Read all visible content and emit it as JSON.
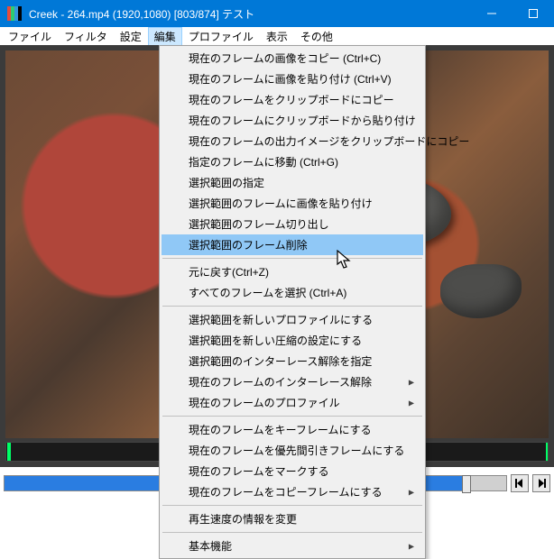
{
  "title": "Creek - 264.mp4 (1920,1080)  [803/874]  テスト",
  "menubar": [
    "ファイル",
    "フィルタ",
    "設定",
    "編集",
    "プロファイル",
    "表示",
    "その他"
  ],
  "menubar_open_index": 3,
  "dropdown": {
    "groups": [
      [
        {
          "label": "現在のフレームの画像をコピー (Ctrl+C)",
          "sub": false
        },
        {
          "label": "現在のフレームに画像を貼り付け (Ctrl+V)",
          "sub": false
        },
        {
          "label": "現在のフレームをクリップボードにコピー",
          "sub": false
        },
        {
          "label": "現在のフレームにクリップボードから貼り付け",
          "sub": false
        },
        {
          "label": "現在のフレームの出力イメージをクリップボードにコピー",
          "sub": false
        },
        {
          "label": "指定のフレームに移動 (Ctrl+G)",
          "sub": false
        },
        {
          "label": "選択範囲の指定",
          "sub": false
        },
        {
          "label": "選択範囲のフレームに画像を貼り付け",
          "sub": false
        },
        {
          "label": "選択範囲のフレーム切り出し",
          "sub": false
        },
        {
          "label": "選択範囲のフレーム削除",
          "sub": false,
          "hl": true
        }
      ],
      [
        {
          "label": "元に戻す(Ctrl+Z)",
          "sub": false
        },
        {
          "label": "すべてのフレームを選択 (Ctrl+A)",
          "sub": false
        }
      ],
      [
        {
          "label": "選択範囲を新しいプロファイルにする",
          "sub": false
        },
        {
          "label": "選択範囲を新しい圧縮の設定にする",
          "sub": false
        },
        {
          "label": "選択範囲のインターレース解除を指定",
          "sub": false
        },
        {
          "label": "現在のフレームのインターレース解除",
          "sub": true
        },
        {
          "label": "現在のフレームのプロファイル",
          "sub": true
        }
      ],
      [
        {
          "label": "現在のフレームをキーフレームにする",
          "sub": false
        },
        {
          "label": "現在のフレームを優先間引きフレームにする",
          "sub": false
        },
        {
          "label": "現在のフレームをマークする",
          "sub": false
        },
        {
          "label": "現在のフレームをコピーフレームにする",
          "sub": true
        }
      ],
      [
        {
          "label": "再生速度の情報を変更",
          "sub": false
        }
      ],
      [
        {
          "label": "基本機能",
          "sub": true
        }
      ]
    ]
  }
}
